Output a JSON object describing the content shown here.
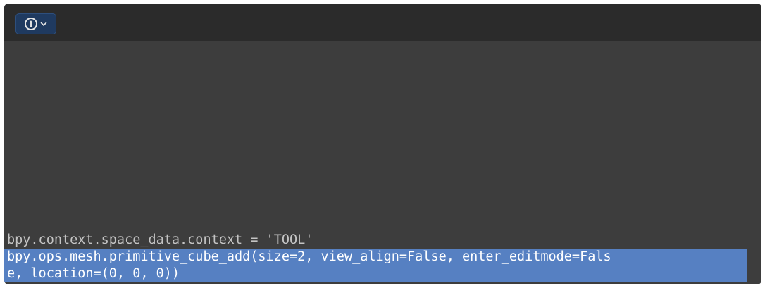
{
  "header": {
    "editor_type_icon": "info-icon",
    "dropdown_icon": "chevron-down-icon",
    "colors": {
      "header_bg": "#2b2b2b",
      "button_bg": "#1f3a60"
    }
  },
  "console": {
    "colors": {
      "background": "#3d3d3d",
      "text": "#c4c4c4",
      "selection": "#5680c2"
    },
    "lines": [
      {
        "text": "bpy.context.space_data.context = 'TOOL'",
        "selected": false
      },
      {
        "text": "bpy.ops.mesh.primitive_cube_add(size=2, view_align=False, enter_editmode=Fals\ne, location=(0, 0, 0))",
        "selected": true
      }
    ]
  }
}
